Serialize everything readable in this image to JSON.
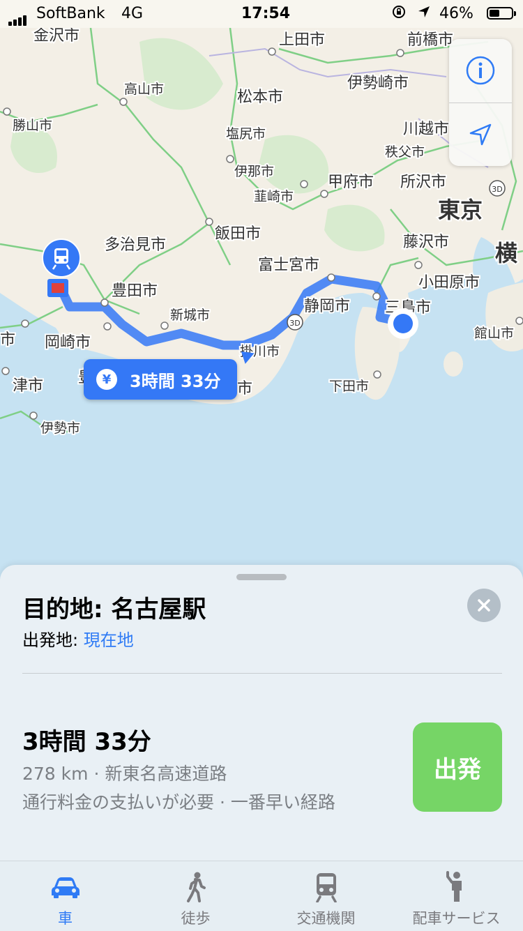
{
  "status_bar": {
    "carrier": "SoftBank",
    "network": "4G",
    "time": "17:54",
    "battery": "46%",
    "battery_level": 0.46
  },
  "map": {
    "labels": {
      "kanazawa": "金沢市",
      "ueda": "上田市",
      "maebashi": "前橋市",
      "takayama": "高山市",
      "isesaki": "伊勢崎市",
      "matsumoto": "松本市",
      "katsuyama": "勝山市",
      "shiojiri": "塩尻市",
      "kawagoe": "川越市",
      "chichibu": "秩父市",
      "ina": "伊那市",
      "kofu": "甲府市",
      "tokorozawa": "所沢市",
      "tokyo": "東京",
      "nirasaki": "韮崎市",
      "iida": "飯田市",
      "tajimi": "多治見市",
      "fujisawa": "藤沢市",
      "yoko": "横",
      "fujinomiya": "富士宮市",
      "toyota": "豊田市",
      "odawara": "小田原市",
      "shizuoka": "静岡市",
      "mishima": "三島市",
      "shinshiro": "新城市",
      "shi_left": "市",
      "okazaki": "岡崎市",
      "kakegawa": "掛川市",
      "tateyama": "館山市",
      "tsu": "津市",
      "shi_mid": "市",
      "shimoda": "下田市",
      "ise": "伊勢市",
      "badge_3d_1": "3D",
      "badge_3d_2": "3D",
      "toyohashi_fragment": "豊"
    },
    "route_badge": {
      "icon": "yen-icon",
      "time": "3時間 33分"
    },
    "controls": {
      "info": "info-icon",
      "location": "location-arrow-icon"
    },
    "colors": {
      "route": "#3478f6",
      "accent": "#2f7bf5",
      "go": "#76d566"
    }
  },
  "directions": {
    "destination": "目的地: 名古屋駅",
    "origin_label": "出発地: ",
    "origin_value": "現在地",
    "duration": "3時間 33分",
    "distance": "278 km · 新東名高速道路",
    "note": "通行料金の支払いが必要 · 一番早い経路",
    "go_button": "出発"
  },
  "tabs": [
    {
      "label": "車",
      "icon": "car-icon",
      "active": true
    },
    {
      "label": "徒歩",
      "icon": "walk-icon",
      "active": false
    },
    {
      "label": "交通機関",
      "icon": "train-icon",
      "active": false
    },
    {
      "label": "配車サービス",
      "icon": "rideshare-icon",
      "active": false
    }
  ]
}
